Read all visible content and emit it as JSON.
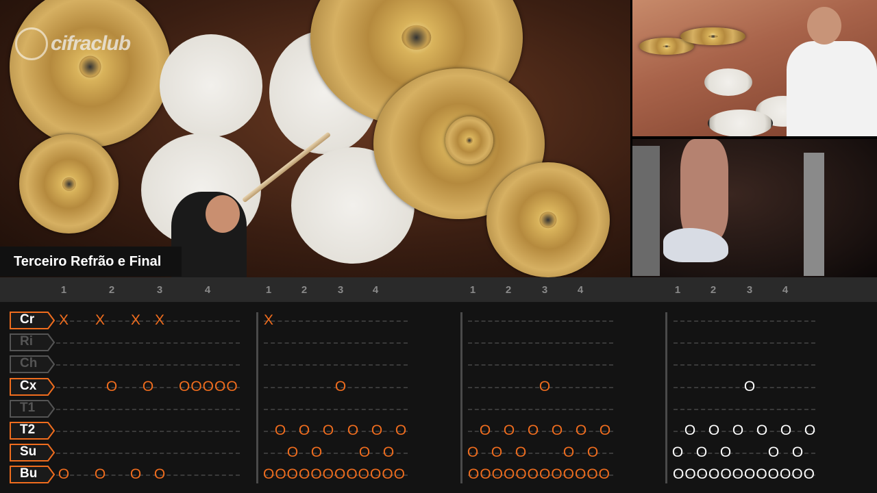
{
  "logo_text": "cifraclub",
  "section_title": "Terceiro Refrão e Final",
  "beats": [
    "1",
    "2",
    "3",
    "4"
  ],
  "instruments": [
    {
      "abbr": "Cr",
      "active": true
    },
    {
      "abbr": "Ri",
      "active": false
    },
    {
      "abbr": "Ch",
      "active": false
    },
    {
      "abbr": "Cx",
      "active": true
    },
    {
      "abbr": "T1",
      "active": false
    },
    {
      "abbr": "T2",
      "active": true
    },
    {
      "abbr": "Su",
      "active": true
    },
    {
      "abbr": "Bu",
      "active": true
    }
  ],
  "colors": {
    "played": "#f06d1e",
    "upcoming": "#ffffff",
    "label_border": "#f06d1e",
    "label_dim": "#555555"
  },
  "notes": {
    "cr_x": "X",
    "hit_o": "O",
    "cx_roll": "OOOOO",
    "bu_roll": "OOOOOOOOOOOO",
    "bu_roll_last": "OOOOOOOOOOOO"
  }
}
